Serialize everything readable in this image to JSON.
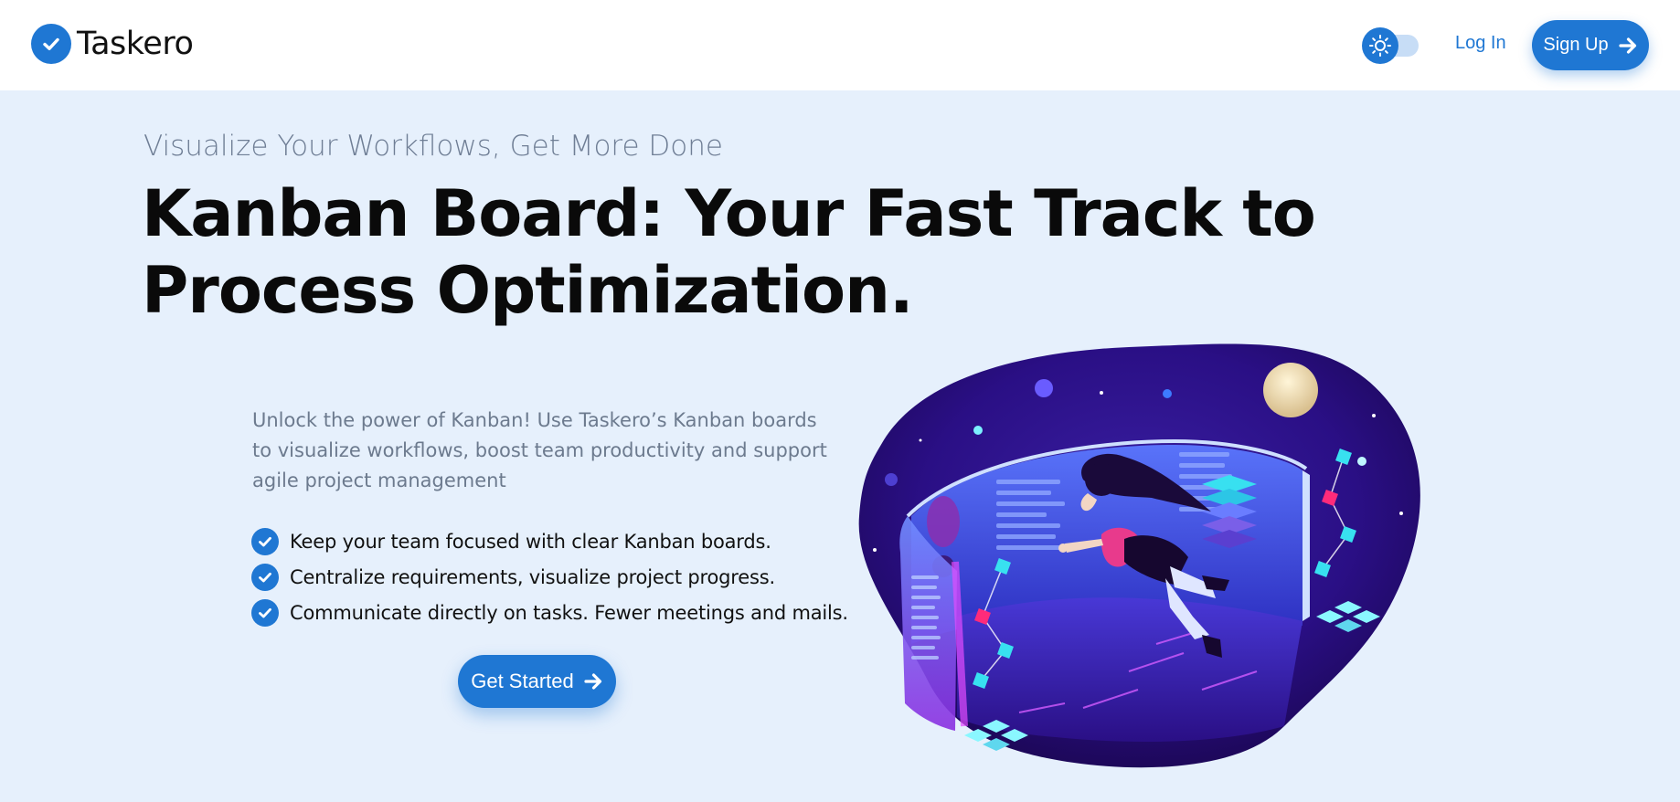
{
  "header": {
    "brand": "Taskero",
    "login_label": "Log In",
    "signup_label": "Sign Up"
  },
  "hero": {
    "eyebrow": "Visualize Your Workflows, Get More Done",
    "title": "Kanban Board: Your Fast Track to Process Optimization.",
    "intro": "Unlock the power of Kanban! Use Taskero’s Kanban boards to visualize workflows, boost team productivity and support agile project management",
    "features": [
      "Keep your team focused with clear Kanban boards.",
      "Centralize requirements, visualize project progress.",
      "Communicate directly on tasks. Fewer meetings and mails."
    ],
    "cta_label": "Get Started"
  },
  "icons": {
    "logo": "check-circle-icon",
    "theme": "sun-icon",
    "arrow": "arrow-right-icon",
    "feature": "check-circle-icon"
  },
  "colors": {
    "accent": "#1f77d3",
    "background": "#e6f0fc",
    "header": "#ffffff",
    "muted_text": "#6f7e95"
  }
}
